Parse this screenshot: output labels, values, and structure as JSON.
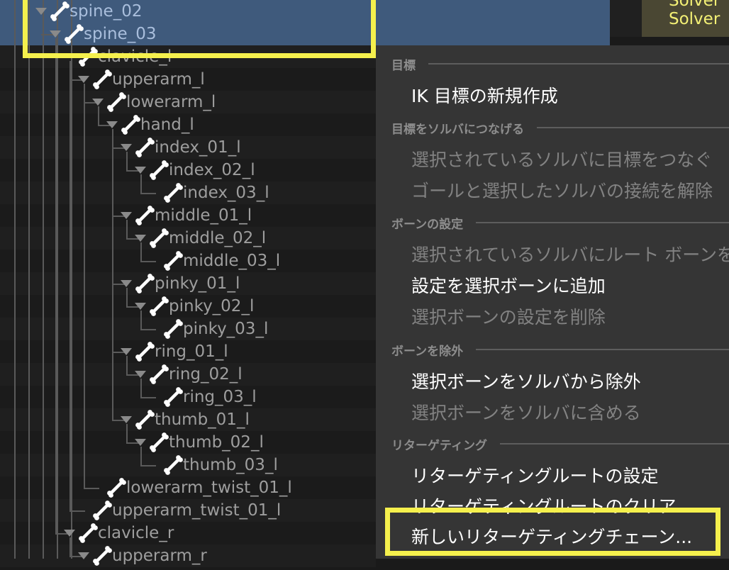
{
  "tree": {
    "rows": [
      {
        "label": "spine_02",
        "expanded": true,
        "highlight": true
      },
      {
        "label": "spine_03",
        "expanded": true,
        "highlight": true
      },
      {
        "label": "clavicle_l",
        "expanded": false
      },
      {
        "label": "upperarm_l",
        "expanded": true
      },
      {
        "label": "lowerarm_l",
        "expanded": true
      },
      {
        "label": "hand_l",
        "expanded": true
      },
      {
        "label": "index_01_l",
        "expanded": true
      },
      {
        "label": "index_02_l",
        "expanded": true
      },
      {
        "label": "index_03_l",
        "expanded": false
      },
      {
        "label": "middle_01_l",
        "expanded": true
      },
      {
        "label": "middle_02_l",
        "expanded": true
      },
      {
        "label": "middle_03_l",
        "expanded": false
      },
      {
        "label": "pinky_01_l",
        "expanded": true
      },
      {
        "label": "pinky_02_l",
        "expanded": true
      },
      {
        "label": "pinky_03_l",
        "expanded": false
      },
      {
        "label": "ring_01_l",
        "expanded": true
      },
      {
        "label": "ring_02_l",
        "expanded": true
      },
      {
        "label": "ring_03_l",
        "expanded": false
      },
      {
        "label": "thumb_01_l",
        "expanded": true
      },
      {
        "label": "thumb_02_l",
        "expanded": true
      },
      {
        "label": "thumb_03_l",
        "expanded": false
      },
      {
        "label": "lowerarm_twist_01_l",
        "expanded": false
      },
      {
        "label": "upperarm_twist_01_l",
        "expanded": false
      },
      {
        "label": "clavicle_r",
        "expanded": true
      },
      {
        "label": "upperarm_r",
        "expanded": true
      }
    ]
  },
  "top_right_panel": {
    "line1": "Solver",
    "line2": "Solver"
  },
  "context_menu": {
    "sections": [
      {
        "header": "目標",
        "items": [
          {
            "label": "IK 目標の新規作成",
            "enabled": true
          }
        ]
      },
      {
        "header": "目標をソルバにつなげる",
        "items": [
          {
            "label": "選択されているソルバに目標をつなぐ",
            "enabled": false
          },
          {
            "label": "ゴールと選択したソルバの接続を解除",
            "enabled": false
          }
        ]
      },
      {
        "header": "ボーンの設定",
        "items": [
          {
            "label": "選択されているソルバにルート ボーンを",
            "enabled": false
          },
          {
            "label": "設定を選択ボーンに追加",
            "enabled": true
          },
          {
            "label": "選択ボーンの設定を削除",
            "enabled": false
          }
        ]
      },
      {
        "header": "ボーンを除外",
        "items": [
          {
            "label": "選択ボーンをソルバから除外",
            "enabled": true
          },
          {
            "label": "選択ボーンをソルバに含める",
            "enabled": false
          }
        ]
      },
      {
        "header": "リターゲティング",
        "items": [
          {
            "label": "リターゲティングルートの設定",
            "enabled": true
          },
          {
            "label": "リターゲティングルートのクリア",
            "enabled": true
          },
          {
            "label": "新しいリターゲティングチェーン...",
            "enabled": true
          }
        ]
      }
    ]
  }
}
